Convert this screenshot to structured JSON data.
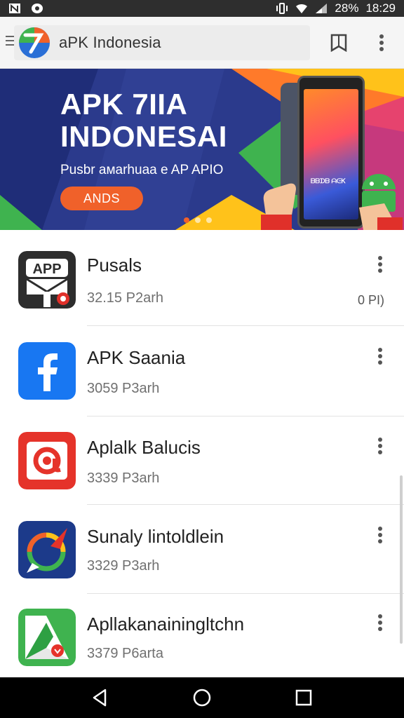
{
  "status_bar": {
    "battery": "28%",
    "time": "18:29",
    "icons": [
      "notification-n-icon",
      "message-icon",
      "vibrate-icon",
      "wifi-icon",
      "signal-icon"
    ]
  },
  "app_bar": {
    "title": "aPK Indonesia",
    "icons": [
      "menu-icon",
      "site-logo",
      "bookmark-icon",
      "more-vert-icon"
    ]
  },
  "banner": {
    "title_line1": "APK 7IIA",
    "title_line2": "INDONESAI",
    "subtitle": "Pusbr aмarhuaa e AP APIO",
    "button_label": "ANDS",
    "phone_text": "ᗷᗷᗪᗷ ᗩᕮᏦ",
    "slides": 3,
    "active_slide": 0,
    "colors": {
      "accent": "#f0612a",
      "base": "#2b3a8c"
    }
  },
  "apps": [
    {
      "name": "Pusals",
      "meta": "32.15  P2arh",
      "right": "0 PI)",
      "icon": "app-envelope-icon"
    },
    {
      "name": "APK Saania",
      "meta": "3059  P3arh",
      "right": "",
      "icon": "facebook-icon"
    },
    {
      "name": "Aplalk Balucis",
      "meta": "3339  P3arh",
      "right": "",
      "icon": "at-sign-icon"
    },
    {
      "name": "Sunaly lintoldlein",
      "meta": "3329  P3arh",
      "right": "",
      "icon": "compass-chat-icon"
    },
    {
      "name": "Apllakanainingltchn",
      "meta": "3379  P6arta",
      "right": "",
      "icon": "maps-icon"
    }
  ],
  "nav": {
    "icons": [
      "back-icon",
      "home-icon",
      "recents-icon"
    ]
  }
}
